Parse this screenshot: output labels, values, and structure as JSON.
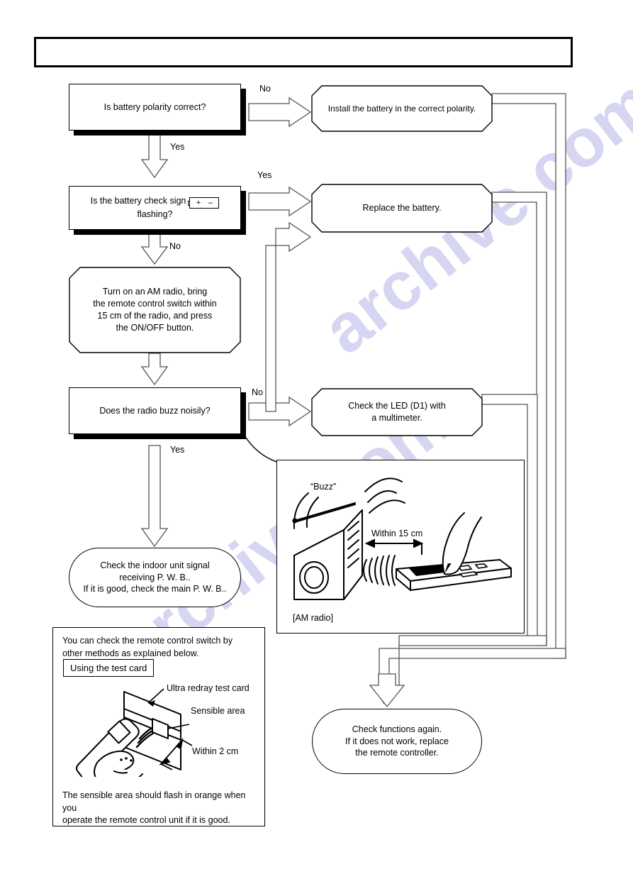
{
  "page": {
    "header_text": "",
    "watermark": "archive.com"
  },
  "flow": {
    "decisions": [
      {
        "id": "battery-polarity",
        "text": "Is battery polarity correct?"
      },
      {
        "id": "battery-check-sign",
        "text_before": "Is the battery check sign",
        "battery_plus": "+",
        "battery_minus": "–",
        "text_after": "flashing?"
      },
      {
        "id": "radio-buzz",
        "text": "Does the radio buzz noisily?"
      }
    ],
    "process": {
      "am_radio_step": "Turn on an AM radio, bring\nthe remote control switch within\n15 cm of the radio, and press\nthe ON/OFF button."
    },
    "actions": [
      {
        "id": "install-battery",
        "text": "Install the battery in the correct polarity."
      },
      {
        "id": "replace-battery",
        "text": "Replace the battery."
      },
      {
        "id": "check-led",
        "text": "Check the LED (D1) with\na multimeter."
      }
    ],
    "terminators": [
      {
        "id": "check-indoor-pwb",
        "text": "Check the indoor unit signal\nreceiving P. W. B..\nIf it is good, check the main P. W. B.."
      },
      {
        "id": "check-functions-again",
        "text": "Check functions again.\nIf it does not work, replace\nthe remote controller."
      }
    ],
    "branch_labels": {
      "polarity_no": "No",
      "polarity_yes": "Yes",
      "check_sign_yes": "Yes",
      "check_sign_no": "No",
      "buzz_no": "No",
      "buzz_yes": "Yes"
    }
  },
  "radio_panel": {
    "buzz_label": "“Buzz”",
    "distance_label": "Within 15 cm",
    "device_label": "[AM radio]"
  },
  "test_card_panel": {
    "intro": "You can check the remote control switch by\nother methods as explained below.",
    "subtitle": "Using the test card",
    "callout_card": "Ultra redray test card",
    "callout_area": "Sensible area",
    "callout_distance": "Within 2 cm",
    "footer": "The sensible area should flash in orange when you\noperate the remote control unit if it is good."
  }
}
